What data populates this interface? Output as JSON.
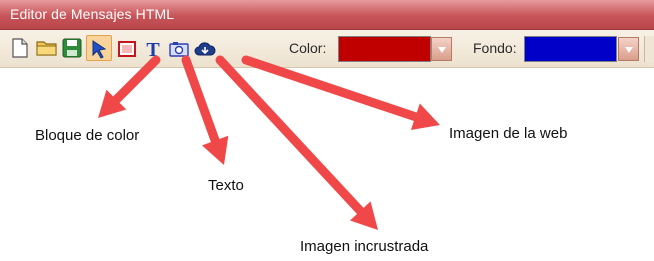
{
  "window": {
    "title": "Editor de Mensajes HTML"
  },
  "toolbar": {
    "buttons": [
      {
        "name": "new-document",
        "icon": "new-document-icon"
      },
      {
        "name": "open-folder",
        "icon": "folder-icon"
      },
      {
        "name": "save",
        "icon": "floppy-disk-icon"
      },
      {
        "name": "select-pointer",
        "icon": "arrow-pointer-icon",
        "active": true
      },
      {
        "name": "color-block",
        "icon": "color-block-icon"
      },
      {
        "name": "text",
        "icon": "text-t-icon"
      },
      {
        "name": "embedded-image",
        "icon": "camera-image-icon"
      },
      {
        "name": "web-image",
        "icon": "cloud-icon"
      }
    ],
    "color_label": "Color:",
    "color_value": "#c00000",
    "background_label": "Fondo:",
    "background_value": "#0000c8"
  },
  "annotations": {
    "color_block": "Bloque de color",
    "text": "Texto",
    "embedded_image": "Imagen incrustrada",
    "web_image": "Imagen de la web",
    "arrow_color": "#f04848"
  }
}
